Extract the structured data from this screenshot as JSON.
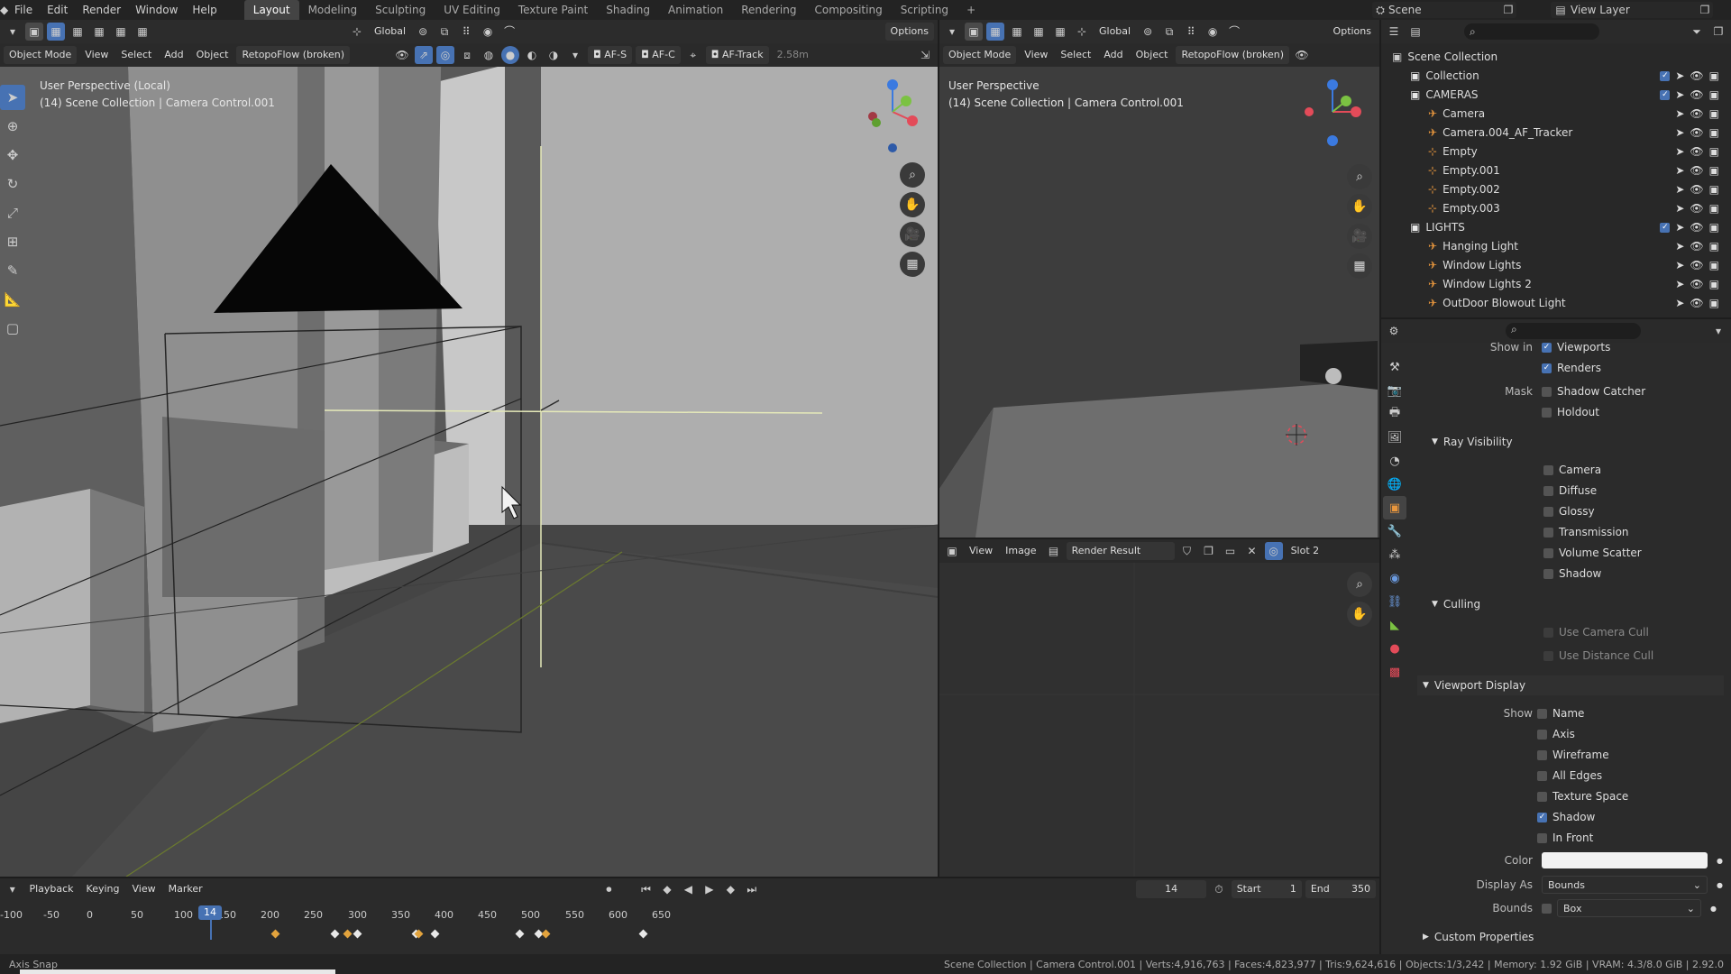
{
  "menu": {
    "items": [
      "File",
      "Edit",
      "Render",
      "Window",
      "Help"
    ],
    "workspaces": [
      "Layout",
      "Modeling",
      "Sculpting",
      "UV Editing",
      "Texture Paint",
      "Shading",
      "Animation",
      "Rendering",
      "Compositing",
      "Scripting"
    ],
    "add": "+",
    "scene": "Scene",
    "view_layer": "View Layer"
  },
  "vp1": {
    "transform": "Global",
    "options": "Options",
    "mode": "Object Mode",
    "view": "View",
    "select": "Select",
    "add": "Add",
    "object": "Object",
    "retopo": "RetopoFlow (broken)",
    "afs": "AF-S",
    "afc": "AF-C",
    "aftrack": "AF-Track",
    "dist": "2.58m",
    "overlay_line1": "User Perspective (Local)",
    "overlay_line2": "(14) Scene Collection | Camera Control.001"
  },
  "vp2": {
    "transform": "Global",
    "options": "Options",
    "mode": "Object Mode",
    "view": "View",
    "select": "Select",
    "add": "Add",
    "object": "Object",
    "retopo": "RetopoFlow (broken)",
    "overlay_line1": "User Perspective",
    "overlay_line2": "(14) Scene Collection | Camera Control.001"
  },
  "image_editor": {
    "view": "View",
    "image": "Image",
    "image_name": "Render Result",
    "slot": "Slot 2"
  },
  "outliner": {
    "rows": [
      {
        "label": "Scene Collection",
        "indent": 0
      },
      {
        "label": "Collection",
        "indent": 1
      },
      {
        "label": "CAMERAS",
        "indent": 1
      },
      {
        "label": "Camera",
        "indent": 2
      },
      {
        "label": "Camera.004_AF_Tracker",
        "indent": 2
      },
      {
        "label": "Empty",
        "indent": 2
      },
      {
        "label": "Empty.001",
        "indent": 2
      },
      {
        "label": "Empty.002",
        "indent": 2
      },
      {
        "label": "Empty.003",
        "indent": 2
      },
      {
        "label": "LIGHTS",
        "indent": 1
      },
      {
        "label": "Hanging Light",
        "indent": 2
      },
      {
        "label": "Window Lights",
        "indent": 2
      },
      {
        "label": "Window Lights 2",
        "indent": 2
      },
      {
        "label": "OutDoor Blowout Light",
        "indent": 2
      }
    ]
  },
  "props": {
    "show_in": "Show in",
    "viewports": "Viewports",
    "renders": "Renders",
    "mask": "Mask",
    "shadow_catcher": "Shadow Catcher",
    "holdout": "Holdout",
    "ray_visibility": "Ray Visibility",
    "ray": [
      "Camera",
      "Diffuse",
      "Glossy",
      "Transmission",
      "Volume Scatter",
      "Shadow"
    ],
    "culling": "Culling",
    "use_camera_cull": "Use Camera Cull",
    "use_distance_cull": "Use Distance Cull",
    "viewport_display": "Viewport Display",
    "show": "Show",
    "vd": [
      {
        "label": "Name",
        "on": false
      },
      {
        "label": "Axis",
        "on": false
      },
      {
        "label": "Wireframe",
        "on": false
      },
      {
        "label": "All Edges",
        "on": false
      },
      {
        "label": "Texture Space",
        "on": false
      },
      {
        "label": "Shadow",
        "on": true
      },
      {
        "label": "In Front",
        "on": false
      }
    ],
    "color": "Color",
    "display_as": "Display As",
    "display_as_value": "Bounds",
    "bounds": "Bounds",
    "bounds_value": "Box",
    "custom_properties": "Custom Properties",
    "color_value": "#f2f2f2"
  },
  "timeline": {
    "playback": "Playback",
    "keying": "Keying",
    "view": "View",
    "marker": "Marker",
    "current": "14",
    "start_label": "Start",
    "start": "1",
    "end_label": "End",
    "end": "350",
    "ticks": [
      "-100",
      "-50",
      "0",
      "50",
      "100",
      "150",
      "200",
      "250",
      "300",
      "350",
      "400",
      "450",
      "500",
      "550",
      "600",
      "650"
    ]
  },
  "status": {
    "left": "Axis Snap",
    "right": "Scene Collection | Camera Control.001 | Verts:4,916,763 | Faces:4,823,977 | Tris:9,624,616 | Objects:1/3,242 | Memory: 1.92 GiB | VRAM: 4.3/8.0 GiB | 2.92.0"
  }
}
